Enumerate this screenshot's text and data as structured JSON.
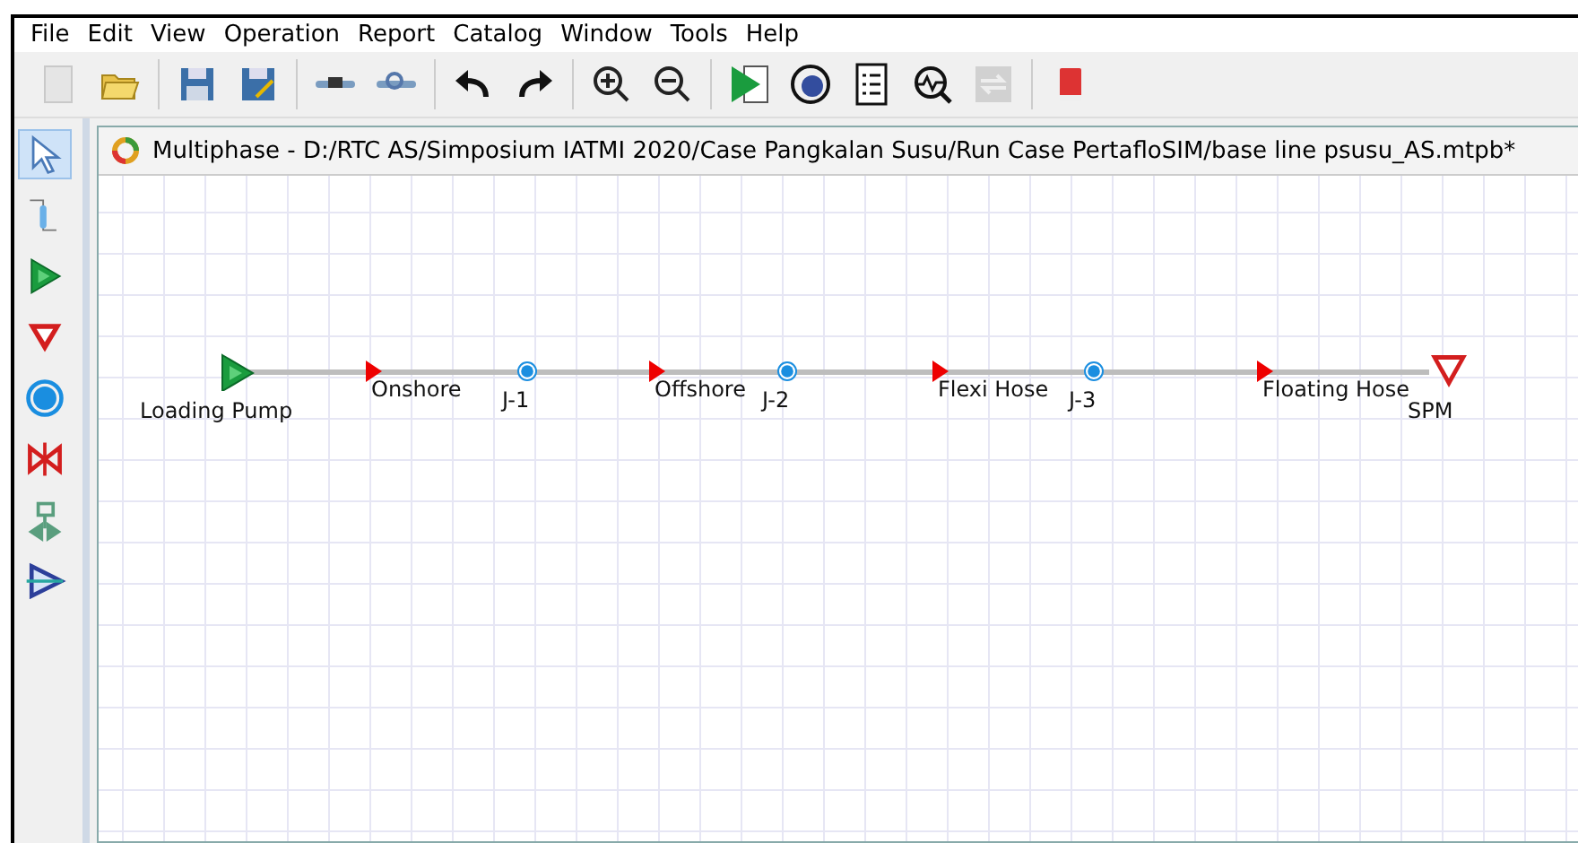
{
  "menu": [
    "File",
    "Edit",
    "View",
    "Operation",
    "Report",
    "Catalog",
    "Window",
    "Tools",
    "Help"
  ],
  "toolbar": [
    {
      "kind": "new",
      "disabled": true
    },
    {
      "kind": "open",
      "disabled": false
    },
    {
      "kind": "sep"
    },
    {
      "kind": "save",
      "disabled": false
    },
    {
      "kind": "saveas",
      "disabled": false
    },
    {
      "kind": "sep"
    },
    {
      "kind": "plugin",
      "disabled": false
    },
    {
      "kind": "plugin2",
      "disabled": false
    },
    {
      "kind": "sep"
    },
    {
      "kind": "undo",
      "disabled": false
    },
    {
      "kind": "redo",
      "disabled": false
    },
    {
      "kind": "sep"
    },
    {
      "kind": "zoomin",
      "disabled": false
    },
    {
      "kind": "zoomout",
      "disabled": false
    },
    {
      "kind": "sep"
    },
    {
      "kind": "run",
      "disabled": false
    },
    {
      "kind": "prun",
      "disabled": false
    },
    {
      "kind": "report",
      "disabled": false
    },
    {
      "kind": "monitor",
      "disabled": false
    },
    {
      "kind": "sync",
      "disabled": true
    },
    {
      "kind": "sep"
    },
    {
      "kind": "book",
      "disabled": false
    }
  ],
  "palette": [
    {
      "kind": "pointer",
      "selected": true
    },
    {
      "kind": "pipe",
      "selected": false
    },
    {
      "kind": "source",
      "selected": false
    },
    {
      "kind": "sink",
      "selected": false
    },
    {
      "kind": "junction",
      "selected": false
    },
    {
      "kind": "valve",
      "selected": false
    },
    {
      "kind": "regulator",
      "selected": false
    },
    {
      "kind": "pump",
      "selected": false
    }
  ],
  "window": {
    "title": "Multiphase - D:/RTC AS/Simposium IATMI 2020/Case Pangkalan Susu/Run Case PertafloSIM/base line psusu_AS.mtpb*"
  },
  "diagram": [
    {
      "kind": "source",
      "label": "Loading Pump"
    },
    {
      "kind": "pipe",
      "label": "Onshore"
    },
    {
      "kind": "junction",
      "label": "J-1"
    },
    {
      "kind": "pipe",
      "label": "Offshore"
    },
    {
      "kind": "junction",
      "label": "J-2"
    },
    {
      "kind": "pipe",
      "label": "Flexi Hose"
    },
    {
      "kind": "junction",
      "label": "J-3"
    },
    {
      "kind": "pipe",
      "label": "Floating Hose"
    },
    {
      "kind": "sink",
      "label": "SPM"
    }
  ]
}
